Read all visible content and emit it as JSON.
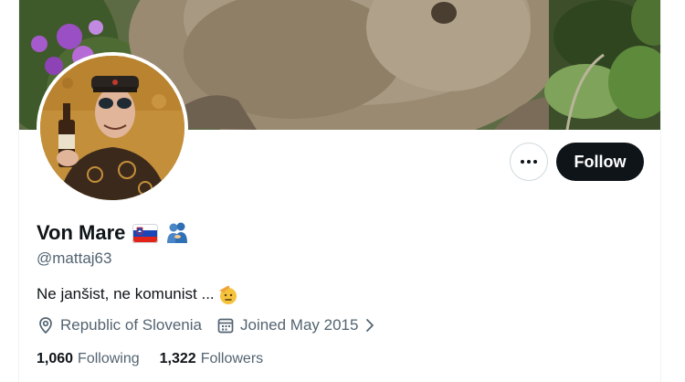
{
  "profile": {
    "display_name": "Von Mare",
    "handle": "@mattaj63",
    "bio": "Ne janšist, ne komunist ...",
    "location": "Republic of Slovenia",
    "joined": "Joined May 2015"
  },
  "actions": {
    "follow_label": "Follow",
    "more_icon": "more-horizontal-icon"
  },
  "stats": {
    "following_count": "1,060",
    "following_label": "Following",
    "followers_count": "1,322",
    "followers_label": "Followers"
  },
  "icons": {
    "flag": "slovenia-flag-icon",
    "people": "people-hugging-icon",
    "salute": "saluting-face-icon",
    "location": "location-pin-icon",
    "calendar": "calendar-icon",
    "chevron": "chevron-right-icon"
  },
  "colors": {
    "primary_text": "#0f1419",
    "secondary_text": "#536471",
    "follow_button": "#0f1419",
    "border": "#cfd9de"
  }
}
